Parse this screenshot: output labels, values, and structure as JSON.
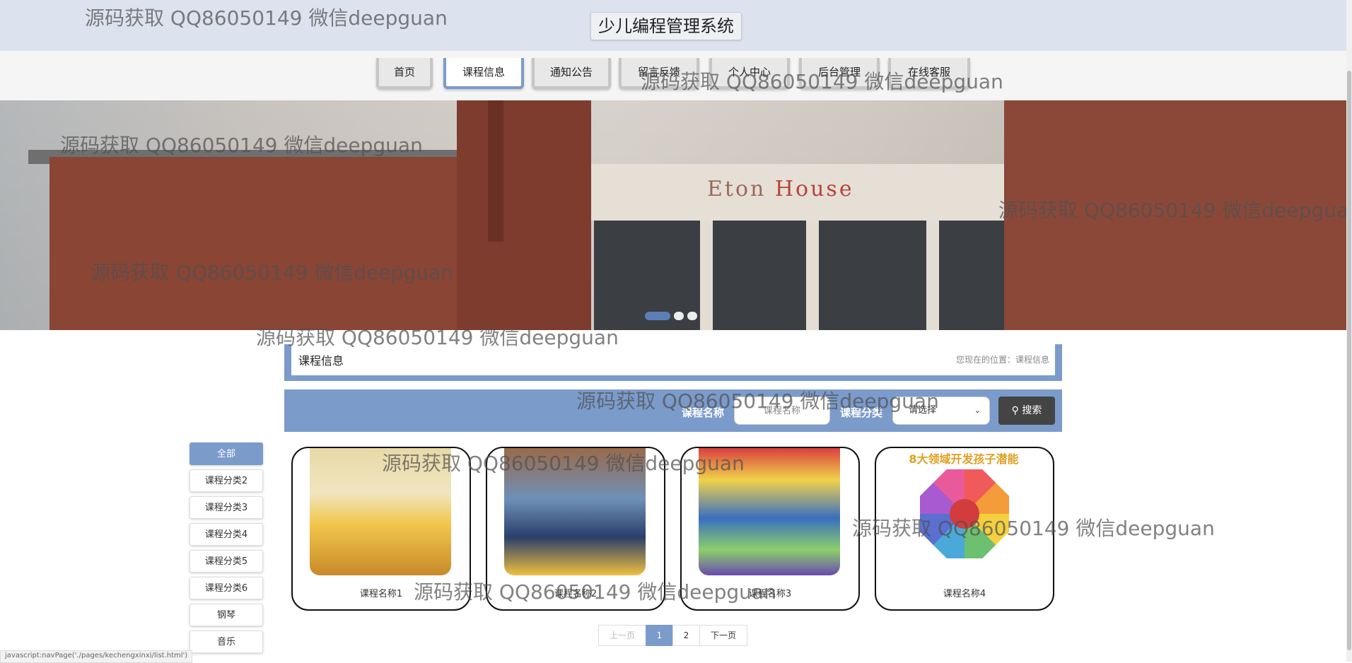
{
  "site_title": "少儿编程管理系统",
  "nav": [
    "首页",
    "课程信息",
    "通知公告",
    "留言反馈",
    "个人中心",
    "后台管理",
    "在线客服"
  ],
  "nav_active_index": 1,
  "banner": {
    "sign_main": "Eton",
    "sign_accent": "House",
    "slide_count": 3,
    "active_slide": 0
  },
  "breadcrumb": {
    "title": "课程信息",
    "location": "您现在的位置：课程信息"
  },
  "search": {
    "name_label": "课程名称",
    "name_placeholder": "课程名称",
    "category_label": "课程分类",
    "category_selected": "请选择",
    "button_label": "搜索"
  },
  "categories": [
    "全部",
    "课程分类2",
    "课程分类3",
    "课程分类4",
    "课程分类5",
    "课程分类6",
    "钢琴",
    "音乐"
  ],
  "active_category": 0,
  "courses": [
    {
      "name": "课程名称1"
    },
    {
      "name": "课程名称2"
    },
    {
      "name": "课程名称3"
    },
    {
      "name": "课程名称4",
      "image_text": "8大领域开发孩子潜能"
    }
  ],
  "pagination": {
    "prev": "上一页",
    "pages": [
      "1",
      "2"
    ],
    "current": "1",
    "next": "下一页"
  },
  "watermark": "源码获取 QQ86050149 微信deepguan",
  "status_url": "javascript:navPage('./pages/kechengxinxi/list.html')",
  "colors": {
    "accent": "#7b9bcb",
    "header_bg": "#dde3ee",
    "search_button": "#444444"
  }
}
